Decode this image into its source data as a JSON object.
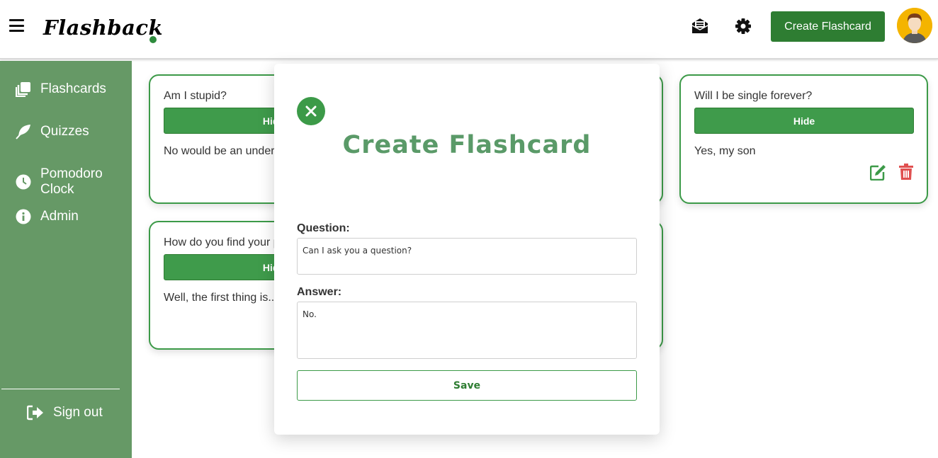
{
  "header": {
    "logo_text": "Flashback",
    "create_button_label": "Create Flashcard",
    "icons": [
      "inbox-icon",
      "gear-icon"
    ],
    "accent_color": "#2e7d32"
  },
  "sidebar": {
    "background_color": "#669966",
    "items": [
      {
        "label": "Flashcards",
        "icon": "cards-icon"
      },
      {
        "label": "Quizzes",
        "icon": "feather-icon"
      },
      {
        "label": "Pomodoro Clock",
        "icon": "clock-icon"
      },
      {
        "label": "Admin",
        "icon": "info-icon"
      }
    ],
    "sign_out_label": "Sign out"
  },
  "cards": [
    {
      "question": "Am I stupid?",
      "hide_label": "Hide",
      "answer": "No would be an under"
    },
    {
      "question": "How do you find your p",
      "hide_label": "Hide",
      "answer": "Well, the first thing is..."
    },
    {
      "question": "Will I be single forever?",
      "hide_label": "Hide",
      "answer": "Yes, my son"
    }
  ],
  "modal": {
    "title": "Create Flashcard",
    "question_label": "Question:",
    "question_value": "Can I ask you a question?",
    "answer_label": "Answer:",
    "answer_value": "No.",
    "save_label": "Save"
  }
}
